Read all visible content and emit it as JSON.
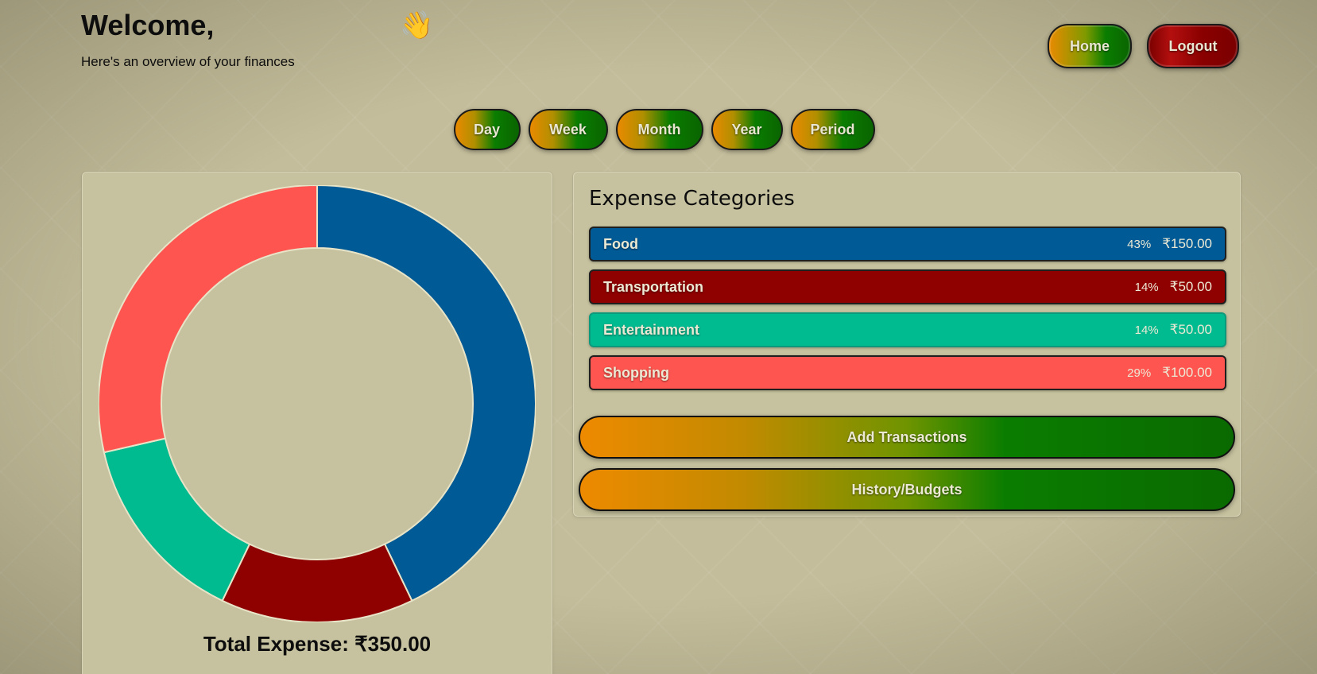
{
  "header": {
    "welcome": "Welcome,",
    "subtitle": "Here's an overview of your finances",
    "wave_emoji": "👋"
  },
  "nav": {
    "home_label": "Home",
    "logout_label": "Logout"
  },
  "periods": [
    "Day",
    "Week",
    "Month",
    "Year",
    "Period"
  ],
  "expense_categories": {
    "title": "Expense Categories",
    "items": [
      {
        "name": "Food",
        "percent": "43%",
        "amount": "₹150.00",
        "color": "#005a96"
      },
      {
        "name": "Transportation",
        "percent": "14%",
        "amount": "₹50.00",
        "color": "#8f0000"
      },
      {
        "name": "Entertainment",
        "percent": "14%",
        "amount": "₹50.00",
        "color": "#00ba90"
      },
      {
        "name": "Shopping",
        "percent": "29%",
        "amount": "₹100.00",
        "color": "#ff5550"
      }
    ]
  },
  "actions": {
    "add_transactions": "Add Transactions",
    "history_budgets": "History/Budgets"
  },
  "total_expense": "Total Expense: ₹350.00",
  "chart_data": {
    "type": "pie",
    "categories": [
      "Food",
      "Transportation",
      "Entertainment",
      "Shopping"
    ],
    "values": [
      150,
      50,
      50,
      100
    ],
    "colors": [
      "#005a96",
      "#8f0000",
      "#00ba90",
      "#ff5550"
    ],
    "donut": true
  }
}
